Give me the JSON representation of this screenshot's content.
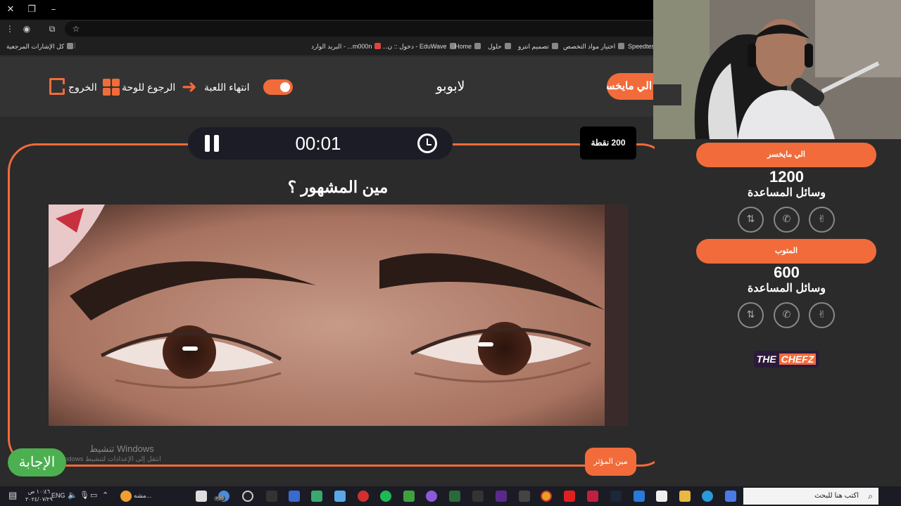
{
  "bookmarks": {
    "all": "كل الإشارات المرجعية",
    "items": [
      "m000n... - البريد الوارد",
      "EduWave - دخول :: ن...",
      "Home",
      "حلول",
      "تصميم انترو",
      "اختيار مواد التخصص",
      "Speedtest"
    ]
  },
  "header": {
    "exit": "الخروج",
    "back_board": "الرجوع للوحة",
    "end_game": "انتهاء اللعبة",
    "brand": "لابوبو",
    "current_team_tab": "الي مايخسر"
  },
  "question": {
    "timer": "00:01",
    "points": "200 نقطة",
    "text": "مين المشهور ؟",
    "answer_button": "الإجابة",
    "effect_button": "مين المؤثر"
  },
  "watermark": {
    "line1": "تنشيط Windows",
    "line2": "انتقل إلى الإعدادات لتنشيط Windows"
  },
  "teams": [
    {
      "name": "الي مايخسر",
      "score": "1200",
      "aids_label": "وسائل المساعدة"
    },
    {
      "name": "المتوب",
      "score": "600",
      "aids_label": "وسائل المساعدة"
    }
  ],
  "lifelines": [
    "two-answers-icon",
    "phone-icon",
    "swap-icon"
  ],
  "logo": {
    "part1": "THE",
    "part2": "CHEFZ"
  },
  "taskbar": {
    "search_placeholder": "اكتب هنا للبحث",
    "language": "ENG",
    "time": "١٠:٤٦ ص",
    "date": "٢٠٢٤/٠٧/٢٩",
    "app_label": "مشه...",
    "badge": "+99"
  },
  "colors": {
    "accent": "#f26b3a",
    "answer": "#4caf50",
    "background": "#2b2b2b"
  }
}
